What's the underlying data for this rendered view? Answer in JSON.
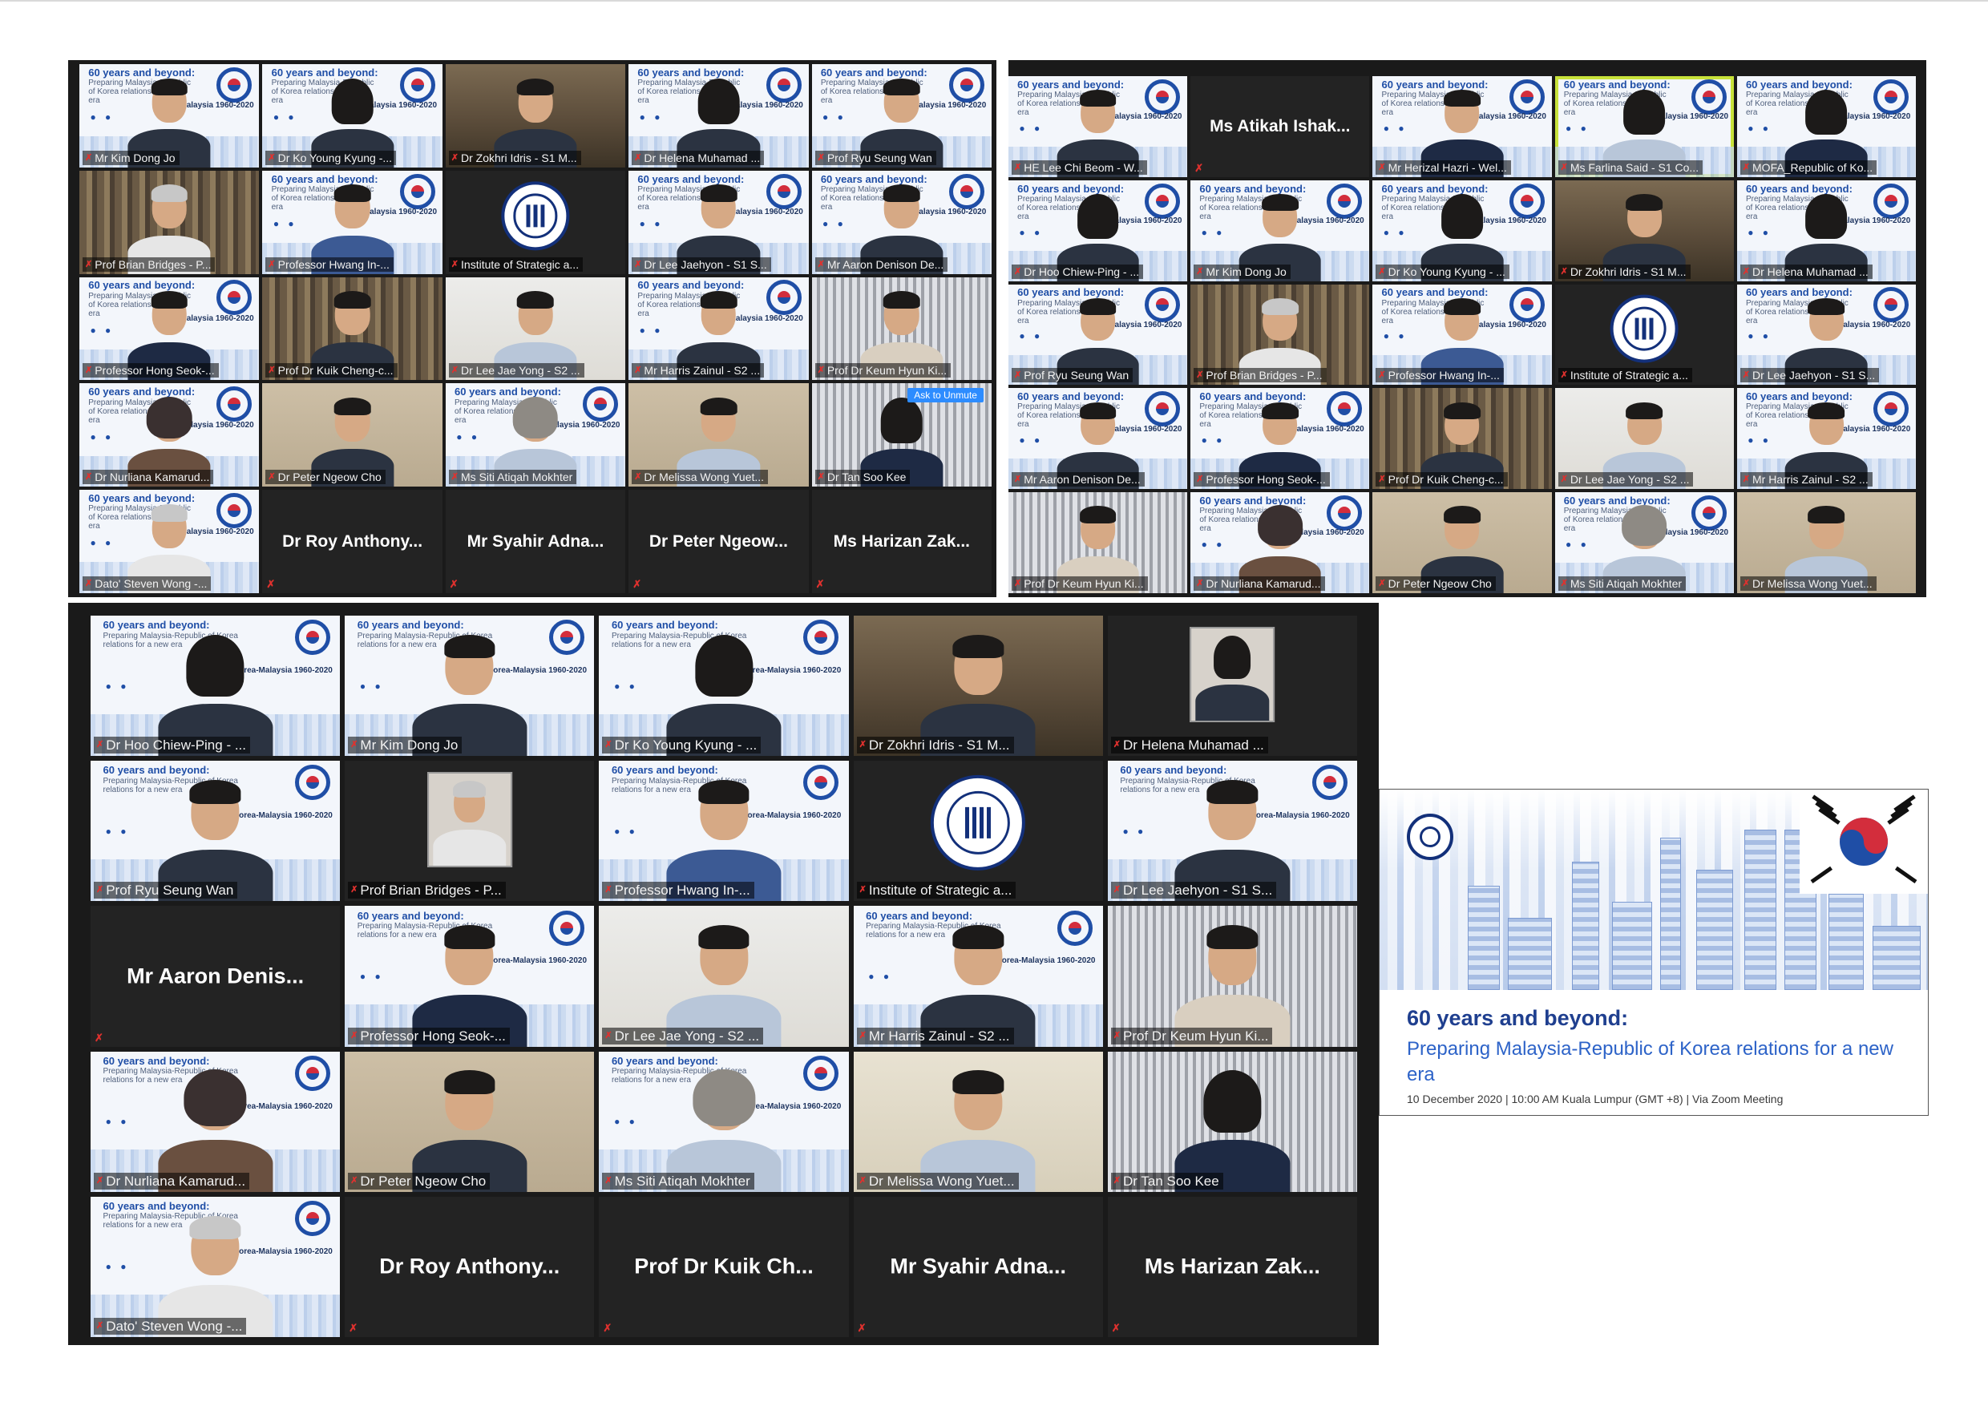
{
  "panels": [
    {
      "tiles": [
        {
          "type": "video",
          "bg": "slide",
          "person": "std",
          "name": "Mr Kim Dong Jo"
        },
        {
          "type": "video",
          "bg": "slide",
          "person": "longhair",
          "name": "Dr Ko Young Kyung -..."
        },
        {
          "type": "video",
          "bg": "room",
          "person": "std",
          "name": "Dr Zokhri Idris - S1 M..."
        },
        {
          "type": "video",
          "bg": "slide",
          "person": "longhair",
          "name": "Dr Helena Muhamad ..."
        },
        {
          "type": "video",
          "bg": "slide",
          "person": "std",
          "name": "Prof Ryu Seung Wan"
        },
        {
          "type": "video",
          "bg": "shelf",
          "person": "grey",
          "body": "white",
          "name": "Prof Brian Bridges - P..."
        },
        {
          "type": "video",
          "bg": "slide",
          "person": "std",
          "body": "blue",
          "name": "Professor Hwang In-..."
        },
        {
          "type": "logo",
          "bg": "dark",
          "name": "Institute of Strategic a..."
        },
        {
          "type": "video",
          "bg": "slide",
          "person": "std",
          "name": "Dr Lee Jaehyon - S1 S..."
        },
        {
          "type": "video",
          "bg": "slide",
          "person": "std",
          "name": "Mr Aaron Denison De..."
        },
        {
          "type": "video",
          "bg": "slide",
          "person": "std",
          "body": "navy",
          "name": "Professor Hong Seok-..."
        },
        {
          "type": "video",
          "bg": "shelf",
          "person": "std",
          "name": "Prof Dr Kuik Cheng-c..."
        },
        {
          "type": "video",
          "bg": "white",
          "person": "std",
          "body": "light",
          "name": "Dr Lee Jae Yong - S2 ..."
        },
        {
          "type": "video",
          "bg": "slide",
          "person": "std",
          "name": "Mr Harris Zainul - S2 ..."
        },
        {
          "type": "video",
          "bg": "blinds",
          "person": "std",
          "body": "cream",
          "name": "Prof Dr Keum Hyun Ki..."
        },
        {
          "type": "video",
          "bg": "slide",
          "person": "hijab-dark",
          "body": "brown",
          "name": "Dr Nurliana Kamarud..."
        },
        {
          "type": "video",
          "bg": "beige",
          "person": "std",
          "name": "Dr Peter Ngeow Cho"
        },
        {
          "type": "video",
          "bg": "slide",
          "person": "hijab",
          "body": "light",
          "name": "Ms Siti Atiqah Mokhter"
        },
        {
          "type": "video",
          "bg": "beige",
          "person": "std",
          "body": "light",
          "name": "Dr Melissa Wong Yuet..."
        },
        {
          "type": "video",
          "bg": "blinds",
          "person": "longhair",
          "body": "navy",
          "name": "Dr Tan Soo Kee",
          "unmute": "Ask to Unmute"
        },
        {
          "type": "video",
          "bg": "slide",
          "person": "grey",
          "body": "white",
          "name": "Dato' Steven Wong -..."
        },
        {
          "type": "name",
          "label": "Dr Roy Anthony..."
        },
        {
          "type": "name",
          "label": "Mr Syahir Adna..."
        },
        {
          "type": "name",
          "label": "Dr Peter Ngeow..."
        },
        {
          "type": "name",
          "label": "Ms Harizan Zak..."
        }
      ]
    },
    {
      "tiles": [
        {
          "type": "video",
          "bg": "slide",
          "person": "std",
          "name": "HE Lee Chi Beom - W..."
        },
        {
          "type": "name",
          "label": "Ms Atikah Ishak..."
        },
        {
          "type": "video",
          "bg": "slide",
          "person": "std",
          "body": "navy",
          "name": "Mr Herizal Hazri - Wel..."
        },
        {
          "type": "video",
          "bg": "slide",
          "person": "longhair",
          "body": "light",
          "name": "Ms Farlina Said - S1 Co...",
          "highlight": true
        },
        {
          "type": "video",
          "bg": "slide",
          "person": "longhair",
          "body": "navy",
          "name": "MOFA_Republic of Ko..."
        },
        {
          "type": "video",
          "bg": "slide",
          "person": "longhair",
          "name": "Dr Hoo Chiew-Ping - ..."
        },
        {
          "type": "video",
          "bg": "slide",
          "person": "std",
          "name": "Mr Kim Dong Jo"
        },
        {
          "type": "video",
          "bg": "slide",
          "person": "longhair",
          "name": "Dr Ko Young Kyung - ..."
        },
        {
          "type": "video",
          "bg": "room",
          "person": "std",
          "name": "Dr Zokhri Idris - S1 M..."
        },
        {
          "type": "video",
          "bg": "slide",
          "person": "longhair",
          "name": "Dr Helena Muhamad ..."
        },
        {
          "type": "video",
          "bg": "slide",
          "person": "std",
          "name": "Prof Ryu Seung Wan"
        },
        {
          "type": "video",
          "bg": "shelf",
          "person": "grey",
          "body": "white",
          "name": "Prof Brian Bridges - P..."
        },
        {
          "type": "video",
          "bg": "slide",
          "person": "std",
          "body": "blue",
          "name": "Professor Hwang In-..."
        },
        {
          "type": "logo",
          "bg": "dark",
          "name": "Institute of Strategic a..."
        },
        {
          "type": "video",
          "bg": "slide",
          "person": "std",
          "name": "Dr Lee Jaehyon - S1 S..."
        },
        {
          "type": "video",
          "bg": "slide",
          "person": "std",
          "name": "Mr Aaron Denison De..."
        },
        {
          "type": "video",
          "bg": "slide",
          "person": "std",
          "body": "navy",
          "name": "Professor Hong Seok-..."
        },
        {
          "type": "video",
          "bg": "shelf",
          "person": "std",
          "name": "Prof Dr Kuik Cheng-c..."
        },
        {
          "type": "video",
          "bg": "white",
          "person": "std",
          "body": "light",
          "name": "Dr Lee Jae Yong - S2 ..."
        },
        {
          "type": "video",
          "bg": "slide",
          "person": "std",
          "name": "Mr Harris Zainul - S2 ..."
        },
        {
          "type": "video",
          "bg": "blinds",
          "person": "std",
          "body": "cream",
          "name": "Prof Dr Keum Hyun Ki..."
        },
        {
          "type": "video",
          "bg": "slide",
          "person": "hijab-dark",
          "body": "brown",
          "name": "Dr Nurliana Kamarud..."
        },
        {
          "type": "video",
          "bg": "beige",
          "person": "std",
          "name": "Dr Peter Ngeow Cho"
        },
        {
          "type": "video",
          "bg": "slide",
          "person": "hijab",
          "body": "light",
          "name": "Ms Siti Atiqah Mokhter"
        },
        {
          "type": "video",
          "bg": "beige",
          "person": "std",
          "body": "light",
          "name": "Dr Melissa Wong Yuet..."
        }
      ]
    },
    {
      "tiles": [
        {
          "type": "video",
          "bg": "slide",
          "person": "longhair",
          "name": "Dr Hoo Chiew-Ping - ..."
        },
        {
          "type": "video",
          "bg": "slide",
          "person": "std",
          "name": "Mr Kim Dong Jo"
        },
        {
          "type": "video",
          "bg": "slide",
          "person": "longhair",
          "name": "Dr Ko Young Kyung - ..."
        },
        {
          "type": "video",
          "bg": "room",
          "person": "std",
          "name": "Dr Zokhri Idris - S1 M..."
        },
        {
          "type": "photo",
          "bg": "dark",
          "person": "longhair",
          "name": "Dr Helena Muhamad ..."
        },
        {
          "type": "video",
          "bg": "slide",
          "person": "std",
          "name": "Prof Ryu Seung Wan"
        },
        {
          "type": "photo",
          "bg": "dark",
          "person": "grey",
          "body": "white",
          "name": "Prof Brian Bridges - P..."
        },
        {
          "type": "video",
          "bg": "slide",
          "person": "std",
          "body": "blue",
          "name": "Professor Hwang In-..."
        },
        {
          "type": "logo",
          "bg": "dark",
          "name": "Institute of Strategic a..."
        },
        {
          "type": "video",
          "bg": "slide",
          "person": "std",
          "name": "Dr Lee Jaehyon - S1 S..."
        },
        {
          "type": "name",
          "label": "Mr Aaron Denis..."
        },
        {
          "type": "video",
          "bg": "slide",
          "person": "std",
          "body": "navy",
          "name": "Professor Hong Seok-..."
        },
        {
          "type": "video",
          "bg": "white",
          "person": "std",
          "body": "light",
          "name": "Dr Lee Jae Yong - S2 ..."
        },
        {
          "type": "video",
          "bg": "slide",
          "person": "std",
          "name": "Mr Harris Zainul - S2 ..."
        },
        {
          "type": "video",
          "bg": "blinds",
          "person": "std",
          "body": "cream",
          "name": "Prof Dr Keum Hyun Ki..."
        },
        {
          "type": "video",
          "bg": "slide",
          "person": "hijab-dark",
          "body": "brown",
          "name": "Dr Nurliana Kamarud..."
        },
        {
          "type": "video",
          "bg": "beige",
          "person": "std",
          "name": "Dr Peter Ngeow Cho"
        },
        {
          "type": "video",
          "bg": "slide",
          "person": "hijab",
          "body": "light",
          "name": "Ms Siti Atiqah Mokhter"
        },
        {
          "type": "video",
          "bg": "cream",
          "person": "std",
          "body": "light",
          "name": "Dr Melissa Wong Yuet..."
        },
        {
          "type": "video",
          "bg": "blinds",
          "person": "longhair",
          "body": "navy",
          "name": "Dr Tan Soo Kee"
        },
        {
          "type": "video",
          "bg": "slide",
          "person": "grey",
          "body": "white",
          "name": "Dato' Steven Wong -..."
        },
        {
          "type": "name",
          "label": "Dr Roy Anthony..."
        },
        {
          "type": "name",
          "label": "Prof Dr Kuik Ch..."
        },
        {
          "type": "name",
          "label": "Mr Syahir Adna..."
        },
        {
          "type": "name",
          "label": "Ms Harizan Zak..."
        }
      ]
    }
  ],
  "slide_bg": {
    "title": "60 years and beyond:",
    "subtitle": "Preparing Malaysia-Republic of Korea relations for a new era",
    "brand": "Korea-Malaysia 1960-2020"
  },
  "banner": {
    "title": "60 years and beyond:",
    "subtitle": "Preparing Malaysia-Republic of Korea relations for a new era",
    "date": "10 December 2020 | 10:00 AM Kuala Lumpur (GMT +8) | Via Zoom Meeting"
  },
  "colors": {
    "panel_bg": "#1a1a1a",
    "mic_muted": "#e0312e",
    "active_speaker": "#c8e23a",
    "unmute_button": "#2d8cff",
    "banner_title": "#1f3f8f",
    "banner_subtitle": "#2d63c8"
  },
  "icons": {
    "mic_muted": "muted-mic-icon",
    "logo": "isis-malaysia-logo-icon",
    "flag": "korea-flag-icon"
  }
}
